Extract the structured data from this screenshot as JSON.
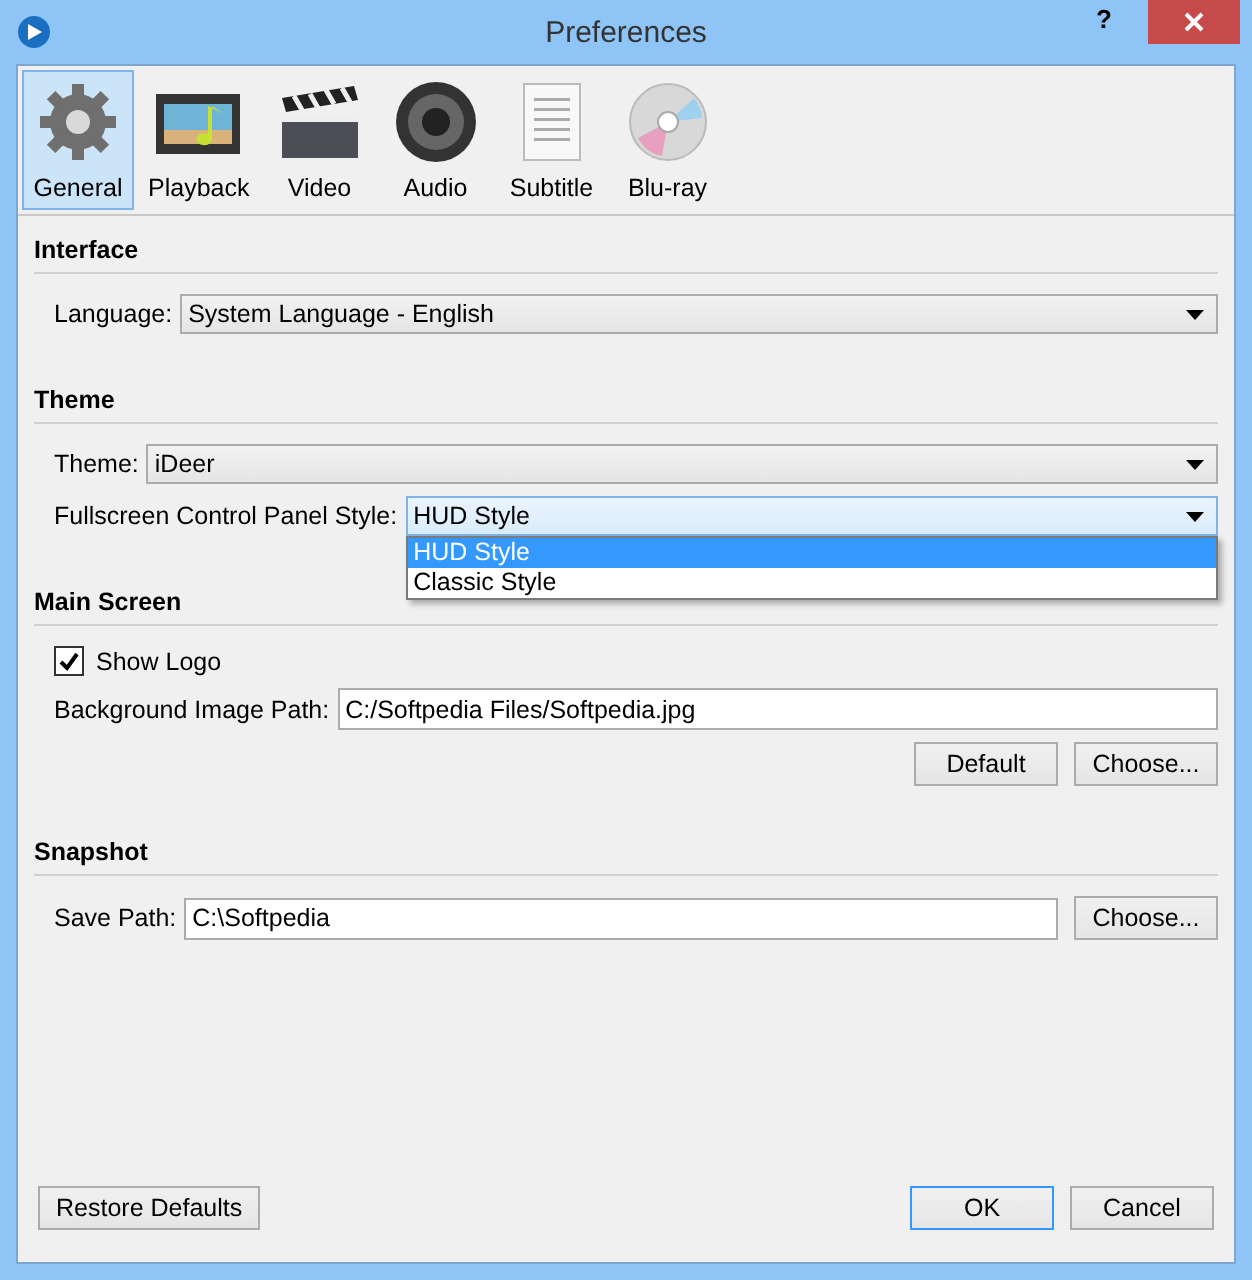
{
  "window": {
    "title": "Preferences",
    "help": "?"
  },
  "toolbar": [
    {
      "label": "General",
      "kind": "gear",
      "selected": true
    },
    {
      "label": "Playback",
      "kind": "film",
      "selected": false
    },
    {
      "label": "Video",
      "kind": "clapper",
      "selected": false
    },
    {
      "label": "Audio",
      "kind": "speaker",
      "selected": false
    },
    {
      "label": "Subtitle",
      "kind": "document",
      "selected": false
    },
    {
      "label": "Blu-ray",
      "kind": "disc",
      "selected": false
    }
  ],
  "sections": [
    {
      "title": "Interface",
      "fields": [
        {
          "kind": "combo",
          "label": "Language:",
          "value": "System Language - English",
          "expanded": false
        }
      ]
    },
    {
      "title": "Theme",
      "fields": [
        {
          "kind": "combo",
          "label": "Theme:",
          "value": "iDeer",
          "expanded": false
        },
        {
          "kind": "combo",
          "label": "Fullscreen Control Panel Style:",
          "value": "HUD Style",
          "expanded": true,
          "options": [
            {
              "label": "HUD Style",
              "selected": true
            },
            {
              "label": "Classic Style",
              "selected": false
            }
          ]
        }
      ]
    },
    {
      "title": "Main Screen",
      "fields": [
        {
          "kind": "checkbox",
          "label": "Show Logo",
          "checked": true
        },
        {
          "kind": "text",
          "label": "Background Image Path:",
          "value": "C:/Softpedia Files/Softpedia.jpg"
        },
        {
          "kind": "buttons",
          "buttons": [
            "Default",
            "Choose..."
          ]
        }
      ]
    },
    {
      "title": "Snapshot",
      "fields": [
        {
          "kind": "text",
          "label": "Save Path:",
          "value": "C:\\Softpedia",
          "button": "Choose..."
        }
      ]
    }
  ],
  "footer": {
    "restore": "Restore Defaults",
    "ok": "OK",
    "cancel": "Cancel"
  }
}
